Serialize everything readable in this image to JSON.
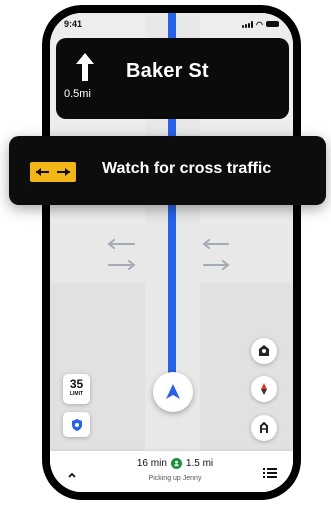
{
  "status_bar": {
    "time": "9:41"
  },
  "navigation": {
    "maneuver_icon": "straight-arrow-icon",
    "distance": "0.5mi",
    "street": "Baker St"
  },
  "alert": {
    "icon": "cross-traffic-icon",
    "text": "Watch for cross traffic",
    "icon_color": "#f3b617"
  },
  "map": {
    "route_color": "#2962e8",
    "speed_limit": {
      "value": "35",
      "label": "LIMIT"
    },
    "buttons": [
      "report-incident-icon",
      "compass-icon",
      "route-options-icon",
      "safety-shield-icon"
    ]
  },
  "trip": {
    "duration": "16 min",
    "distance": "1.5 mi",
    "status": "Picking up Jenny",
    "stop_icon": "rider-icon"
  }
}
